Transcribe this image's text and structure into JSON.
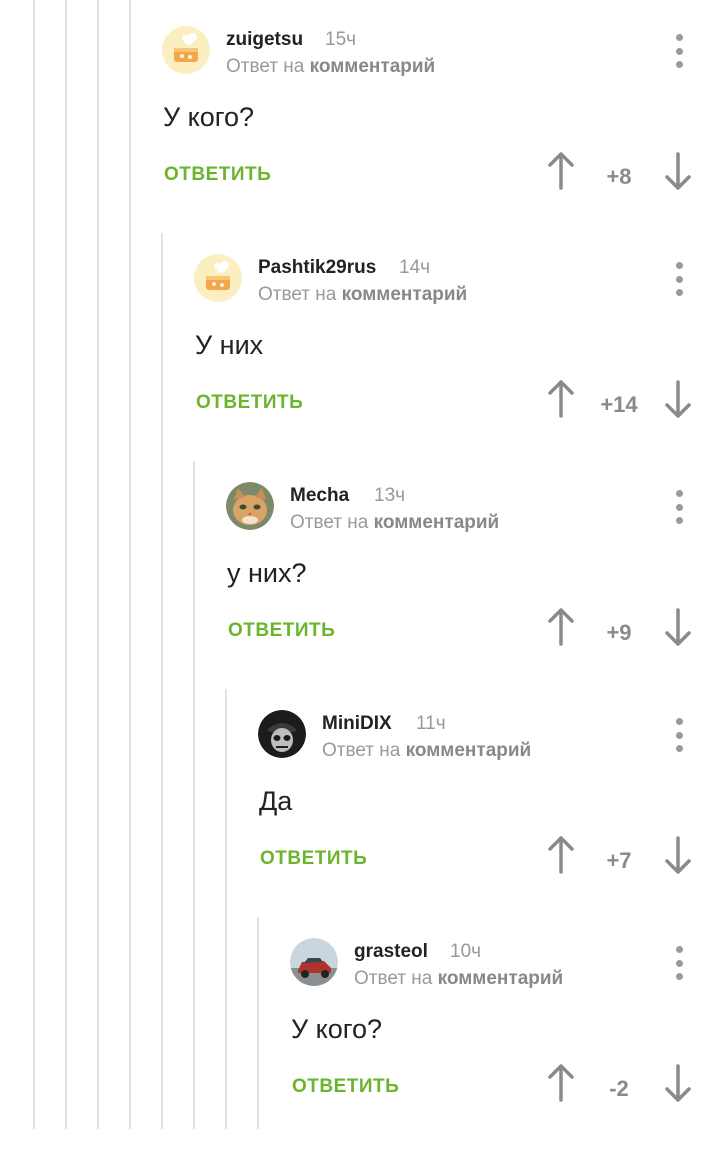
{
  "comments": [
    {
      "author": "zuigetsu",
      "time": "15ч",
      "reply_prefix": "Ответ на",
      "reply_target": "комментарий",
      "text": "У кого?",
      "reply_label": "ОТВЕТИТЬ",
      "rating": "+8",
      "avatar": "cake-avatar"
    },
    {
      "author": "Pashtik29rus",
      "time": "14ч",
      "reply_prefix": "Ответ на",
      "reply_target": "комментарий",
      "text": "У них",
      "reply_label": "ОТВЕТИТЬ",
      "rating": "+14",
      "avatar": "cake-avatar"
    },
    {
      "author": "Mecha",
      "time": "13ч",
      "reply_prefix": "Ответ на",
      "reply_target": "комментарий",
      "text": "у них?",
      "reply_label": "ОТВЕТИТЬ",
      "rating": "+9",
      "avatar": "cat-avatar"
    },
    {
      "author": "MiniDIX",
      "time": "11ч",
      "reply_prefix": "Ответ на",
      "reply_target": "комментарий",
      "text": "Да",
      "reply_label": "ОТВЕТИТЬ",
      "rating": "+7",
      "avatar": "skull-avatar"
    },
    {
      "author": "grasteol",
      "time": "10ч",
      "reply_prefix": "Ответ на",
      "reply_target": "комментарий",
      "text": "У кого?",
      "reply_label": "ОТВЕТИТЬ",
      "rating": "-2",
      "avatar": "car-avatar"
    }
  ],
  "colors": {
    "accent_green": "#6ab42e",
    "muted": "#999999",
    "thread_line": "#e3e3e3"
  }
}
